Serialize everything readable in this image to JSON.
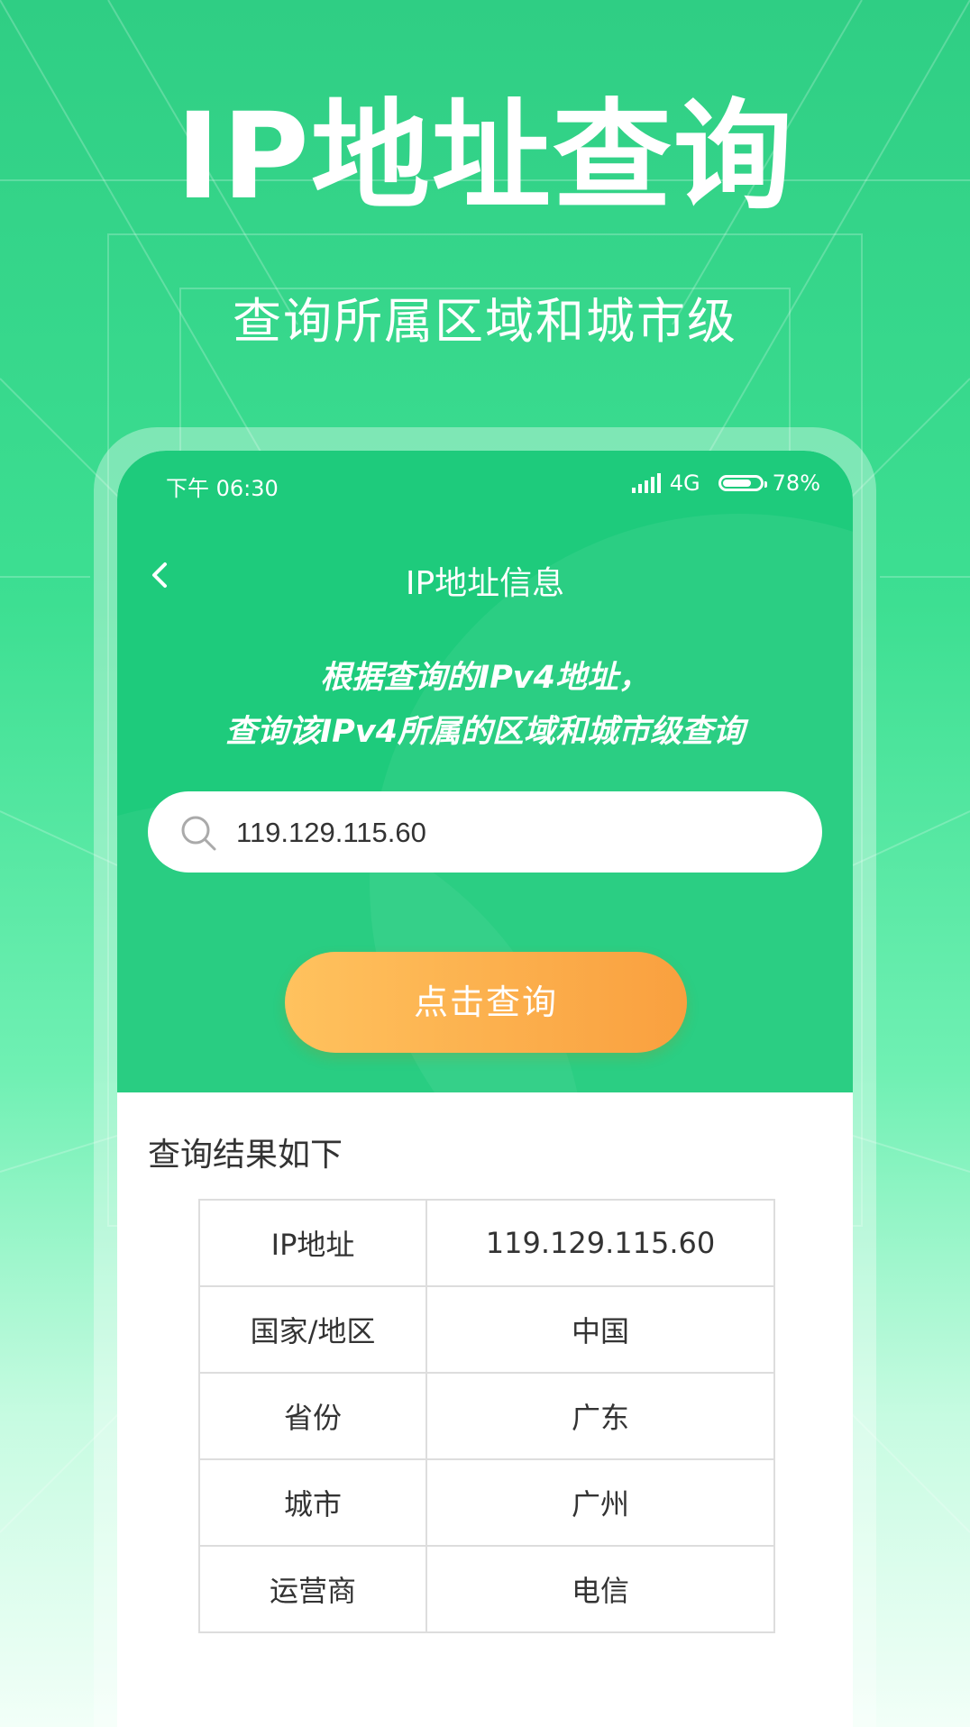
{
  "hero": {
    "title": "IP地址查询",
    "subtitle": "查询所属区域和城市级"
  },
  "status_bar": {
    "time": "下午 06:30",
    "network": "4G",
    "battery": "78%",
    "battery_level": 0.78
  },
  "nav": {
    "back_icon": "chevron-left-icon",
    "title": "IP地址信息"
  },
  "description": {
    "line1": "根据查询的IPv4地址，",
    "line2": "查询该IPv4所属的区域和城市级查询"
  },
  "search": {
    "icon": "search-icon",
    "value": "119.129.115.60"
  },
  "query_button": {
    "label": "点击查询"
  },
  "result": {
    "title": "查询结果如下",
    "rows": [
      {
        "key": "IP地址",
        "value": "119.129.115.60"
      },
      {
        "key": "国家/地区",
        "value": "中国"
      },
      {
        "key": "省份",
        "value": "广东"
      },
      {
        "key": "城市",
        "value": "广州"
      },
      {
        "key": "运营商",
        "value": "电信"
      }
    ]
  },
  "colors": {
    "brand_green": "#1ecb7c",
    "button_orange": "#f9a03f"
  }
}
